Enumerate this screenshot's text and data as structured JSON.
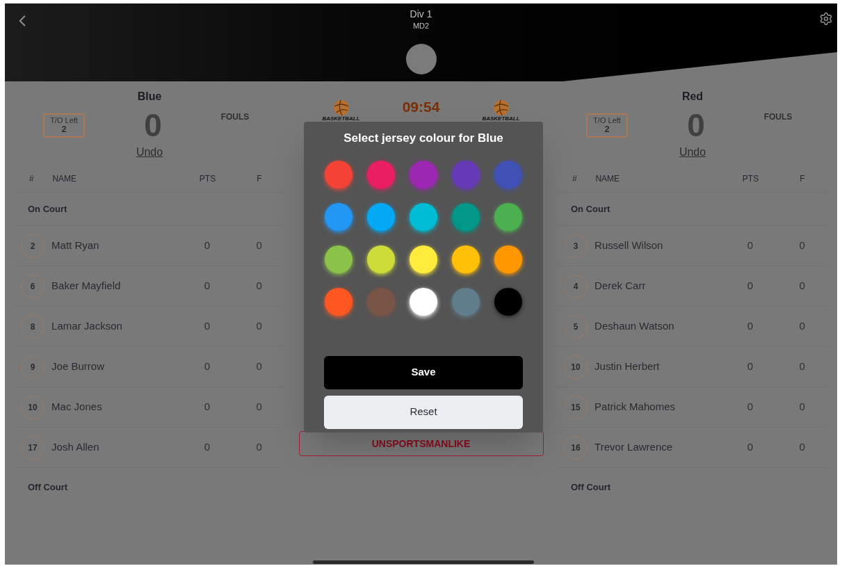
{
  "header": {
    "title": "Div 1",
    "subtitle": "MD2"
  },
  "teams": [
    {
      "name": "Blue",
      "timeouts_label": "T/O Left",
      "timeouts": "2",
      "score": "0",
      "fouls_label": "FOULS",
      "undo": "Undo",
      "columns": [
        "#",
        "NAME",
        "PTS",
        "F"
      ],
      "on_court_label": "On Court",
      "off_court_label": "Off Court",
      "players": [
        {
          "number": "2",
          "name": "Matt Ryan",
          "pts": "0",
          "fouls": "0"
        },
        {
          "number": "6",
          "name": "Baker Mayfield",
          "pts": "0",
          "fouls": "0"
        },
        {
          "number": "8",
          "name": "Lamar Jackson",
          "pts": "0",
          "fouls": "0"
        },
        {
          "number": "9",
          "name": "Joe Burrow",
          "pts": "0",
          "fouls": "0"
        },
        {
          "number": "10",
          "name": "Mac Jones",
          "pts": "0",
          "fouls": "0"
        },
        {
          "number": "17",
          "name": "Josh Allen",
          "pts": "0",
          "fouls": "0"
        }
      ]
    },
    {
      "name": "Red",
      "timeouts_label": "T/O Left",
      "timeouts": "2",
      "score": "0",
      "fouls_label": "FOULS",
      "undo": "Undo",
      "columns": [
        "#",
        "NAME",
        "PTS",
        "F"
      ],
      "on_court_label": "On Court",
      "off_court_label": "Off Court",
      "players": [
        {
          "number": "3",
          "name": "Russell Wilson",
          "pts": "0",
          "fouls": "0"
        },
        {
          "number": "4",
          "name": "Derek Carr",
          "pts": "0",
          "fouls": "0"
        },
        {
          "number": "5",
          "name": "Deshaun Watson",
          "pts": "0",
          "fouls": "0"
        },
        {
          "number": "10",
          "name": "Justin Herbert",
          "pts": "0",
          "fouls": "0"
        },
        {
          "number": "15",
          "name": "Patrick Mahomes",
          "pts": "0",
          "fouls": "0"
        },
        {
          "number": "16",
          "name": "Trevor Lawrence",
          "pts": "0",
          "fouls": "0"
        }
      ]
    }
  ],
  "logos": [
    {
      "caption": "BASKETBALL"
    },
    {
      "caption": "BASKETBALL"
    }
  ],
  "clock": "09:54",
  "foul_button": "UNSPORTSMANLIKE",
  "dialog": {
    "title": "Select jersey colour for Blue",
    "swatches": [
      {
        "color": "#f44336"
      },
      {
        "color": "#e91e63"
      },
      {
        "color": "#9c27b0"
      },
      {
        "color": "#673ab7"
      },
      {
        "color": "#3f51b5"
      },
      {
        "color": "#2196f3"
      },
      {
        "color": "#03a9f4"
      },
      {
        "color": "#00bcd4"
      },
      {
        "color": "#009688"
      },
      {
        "color": "#4caf50"
      },
      {
        "color": "#8bc34a"
      },
      {
        "color": "#cddc39"
      },
      {
        "color": "#ffeb3b"
      },
      {
        "color": "#ffc107"
      },
      {
        "color": "#ff9800"
      },
      {
        "color": "#ff5722"
      },
      {
        "color": "#795548"
      },
      {
        "color": "#ffffff"
      },
      {
        "color": "#607d8b"
      },
      {
        "color": "#000000"
      }
    ],
    "buttons": [
      {
        "label": "Save",
        "kind": "primary"
      },
      {
        "label": "Reset",
        "kind": "secondary"
      }
    ]
  }
}
